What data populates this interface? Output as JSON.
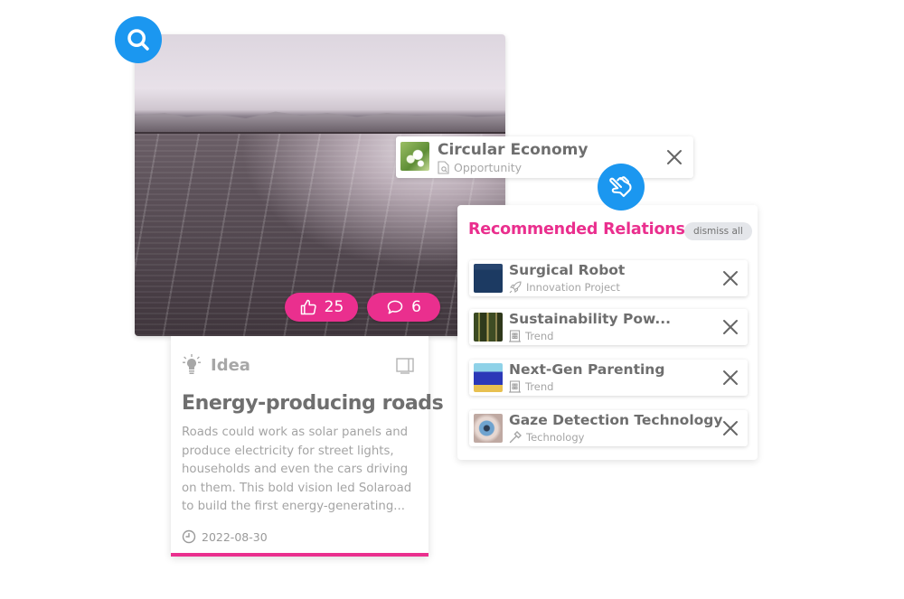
{
  "hero": {
    "likes": "25",
    "comments": "6",
    "colors": {
      "accent": "#ea2f8e",
      "primary": "#1b97f0"
    }
  },
  "idea_card": {
    "type": "Idea",
    "title": "Energy-producing roads",
    "description": "Roads could work as solar panels and produce electricity for street lights, households and even the cars driving on them. This bold vision led Solaroad to build the first energy-generating...",
    "date": "2022-08-30"
  },
  "linked_item": {
    "title": "Circular Economy",
    "type": "Opportunity"
  },
  "recommended": {
    "title": "Recommended Relations",
    "dismiss_label": "dismiss all",
    "items": [
      {
        "title": "Surgical Robot",
        "type": "Innovation Project",
        "icon": "rocket-icon"
      },
      {
        "title": "Sustainability Pow...",
        "type": "Trend",
        "icon": "building-icon"
      },
      {
        "title": "Next-Gen Parenting",
        "type": "Trend",
        "icon": "building-icon"
      },
      {
        "title": "Gaze Detection Technology",
        "type": "Technology",
        "icon": "hammer-icon"
      }
    ]
  }
}
